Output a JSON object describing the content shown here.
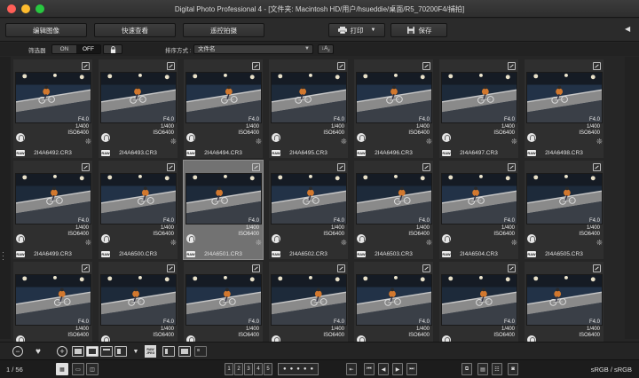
{
  "window": {
    "title": "Digital Photo Professional 4 - [文件夹: Macintosh HD/用户/hsueddie/桌面/R5_70200F4/捕拍]"
  },
  "toolbar": {
    "edit_image": "编辑图像",
    "quick_check": "快速查看",
    "remote_shooting": "遥控拍摄",
    "print": "打印",
    "save": "保存"
  },
  "filter": {
    "label": "筛选器",
    "on": "ON",
    "off": "OFF",
    "state": "OFF",
    "sort_label": "排序方式 :",
    "sort_value": "文件名"
  },
  "thumbnails": [
    {
      "filename": "2I4A6492.CR3",
      "aperture": "F4.0",
      "shutter": "1/400",
      "iso": "ISO6400",
      "raw": "RAW",
      "selected": false
    },
    {
      "filename": "2I4A6493.CR3",
      "aperture": "F4.0",
      "shutter": "1/400",
      "iso": "ISO6400",
      "raw": "RAW",
      "selected": false
    },
    {
      "filename": "2I4A6494.CR3",
      "aperture": "F4.0",
      "shutter": "1/400",
      "iso": "ISO6400",
      "raw": "RAW",
      "selected": false
    },
    {
      "filename": "2I4A6495.CR3",
      "aperture": "F4.0",
      "shutter": "1/400",
      "iso": "ISO6400",
      "raw": "RAW",
      "selected": false
    },
    {
      "filename": "2I4A6496.CR3",
      "aperture": "F4.0",
      "shutter": "1/400",
      "iso": "ISO6400",
      "raw": "RAW",
      "selected": false
    },
    {
      "filename": "2I4A6497.CR3",
      "aperture": "F4.0",
      "shutter": "1/400",
      "iso": "ISO6400",
      "raw": "RAW",
      "selected": false
    },
    {
      "filename": "2I4A6498.CR3",
      "aperture": "F4.0",
      "shutter": "1/400",
      "iso": "ISO6400",
      "raw": "RAW",
      "selected": false
    },
    {
      "filename": "2I4A6499.CR3",
      "aperture": "F4.0",
      "shutter": "1/400",
      "iso": "ISO6400",
      "raw": "RAW",
      "selected": false
    },
    {
      "filename": "2I4A6500.CR3",
      "aperture": "F4.0",
      "shutter": "1/400",
      "iso": "ISO6400",
      "raw": "RAW",
      "selected": false
    },
    {
      "filename": "2I4A6501.CR3",
      "aperture": "F4.0",
      "shutter": "1/400",
      "iso": "ISO6400",
      "raw": "RAW",
      "selected": true
    },
    {
      "filename": "2I4A6502.CR3",
      "aperture": "F4.0",
      "shutter": "1/400",
      "iso": "ISO6400",
      "raw": "RAW",
      "selected": false
    },
    {
      "filename": "2I4A6503.CR3",
      "aperture": "F4.0",
      "shutter": "1/400",
      "iso": "ISO6400",
      "raw": "RAW",
      "selected": false
    },
    {
      "filename": "2I4A6504.CR3",
      "aperture": "F4.0",
      "shutter": "1/400",
      "iso": "ISO6400",
      "raw": "RAW",
      "selected": false
    },
    {
      "filename": "2I4A6505.CR3",
      "aperture": "F4.0",
      "shutter": "1/400",
      "iso": "ISO6400",
      "raw": "RAW",
      "selected": false
    },
    {
      "filename": "",
      "aperture": "F4.0",
      "shutter": "1/400",
      "iso": "ISO6400",
      "raw": "",
      "selected": false
    },
    {
      "filename": "",
      "aperture": "F4.0",
      "shutter": "1/400",
      "iso": "ISO6400",
      "raw": "",
      "selected": false
    },
    {
      "filename": "",
      "aperture": "F4.0",
      "shutter": "1/400",
      "iso": "ISO6400",
      "raw": "",
      "selected": false
    },
    {
      "filename": "",
      "aperture": "F4.0",
      "shutter": "1/400",
      "iso": "ISO6400",
      "raw": "",
      "selected": false
    },
    {
      "filename": "",
      "aperture": "F4.0",
      "shutter": "1/400",
      "iso": "ISO6400",
      "raw": "",
      "selected": false
    },
    {
      "filename": "",
      "aperture": "F4.0",
      "shutter": "1/400",
      "iso": "ISO6400",
      "raw": "",
      "selected": false
    },
    {
      "filename": "",
      "aperture": "F4.0",
      "shutter": "1/400",
      "iso": "ISO6400",
      "raw": "",
      "selected": false
    }
  ],
  "bottom_toolbar": {
    "raw_badge": "RAW JPEG"
  },
  "statusbar": {
    "count": "1 / 56",
    "ratings": [
      "1",
      "2",
      "3",
      "4",
      "5"
    ],
    "colorspace": "sRGB / sRGB"
  },
  "colors": {
    "background": "#262626",
    "selected_thumb": "#727272"
  }
}
